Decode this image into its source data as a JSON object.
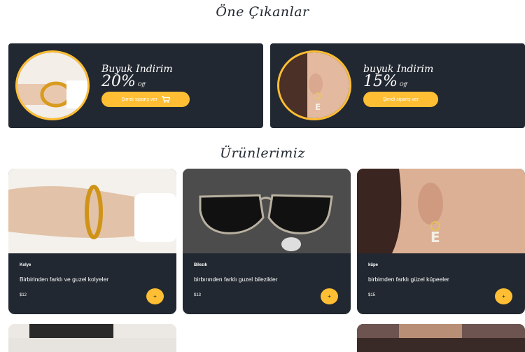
{
  "sections": {
    "featured_title": "Öne Çıkanlar",
    "products_title": "Ürünlerimiz"
  },
  "offers": [
    {
      "title": "Buyuk Indirim",
      "percent": "20%",
      "off": "Off",
      "button": "Şimdi sipariş ver"
    },
    {
      "title": "buyuk Indirim",
      "percent": "15%",
      "off": "Off",
      "button": "Şimdi sipariş ver"
    }
  ],
  "products": [
    {
      "name": "Kolye",
      "description": "Birbirinden farklı ve guzel kolyeler",
      "price": "$12",
      "add_label": "+"
    },
    {
      "name": "Bilezık",
      "description": "birbırınden farklı guzel bilezikler",
      "price": "$13",
      "add_label": "+"
    },
    {
      "name": "küpe",
      "description": "birbimden farklı güzel küpeeler",
      "price": "$15",
      "add_label": "+"
    }
  ],
  "icons": {
    "cart": "cart-icon",
    "add": "plus-icon"
  },
  "colors": {
    "dark": "#222831",
    "accent": "#ffbe33"
  }
}
